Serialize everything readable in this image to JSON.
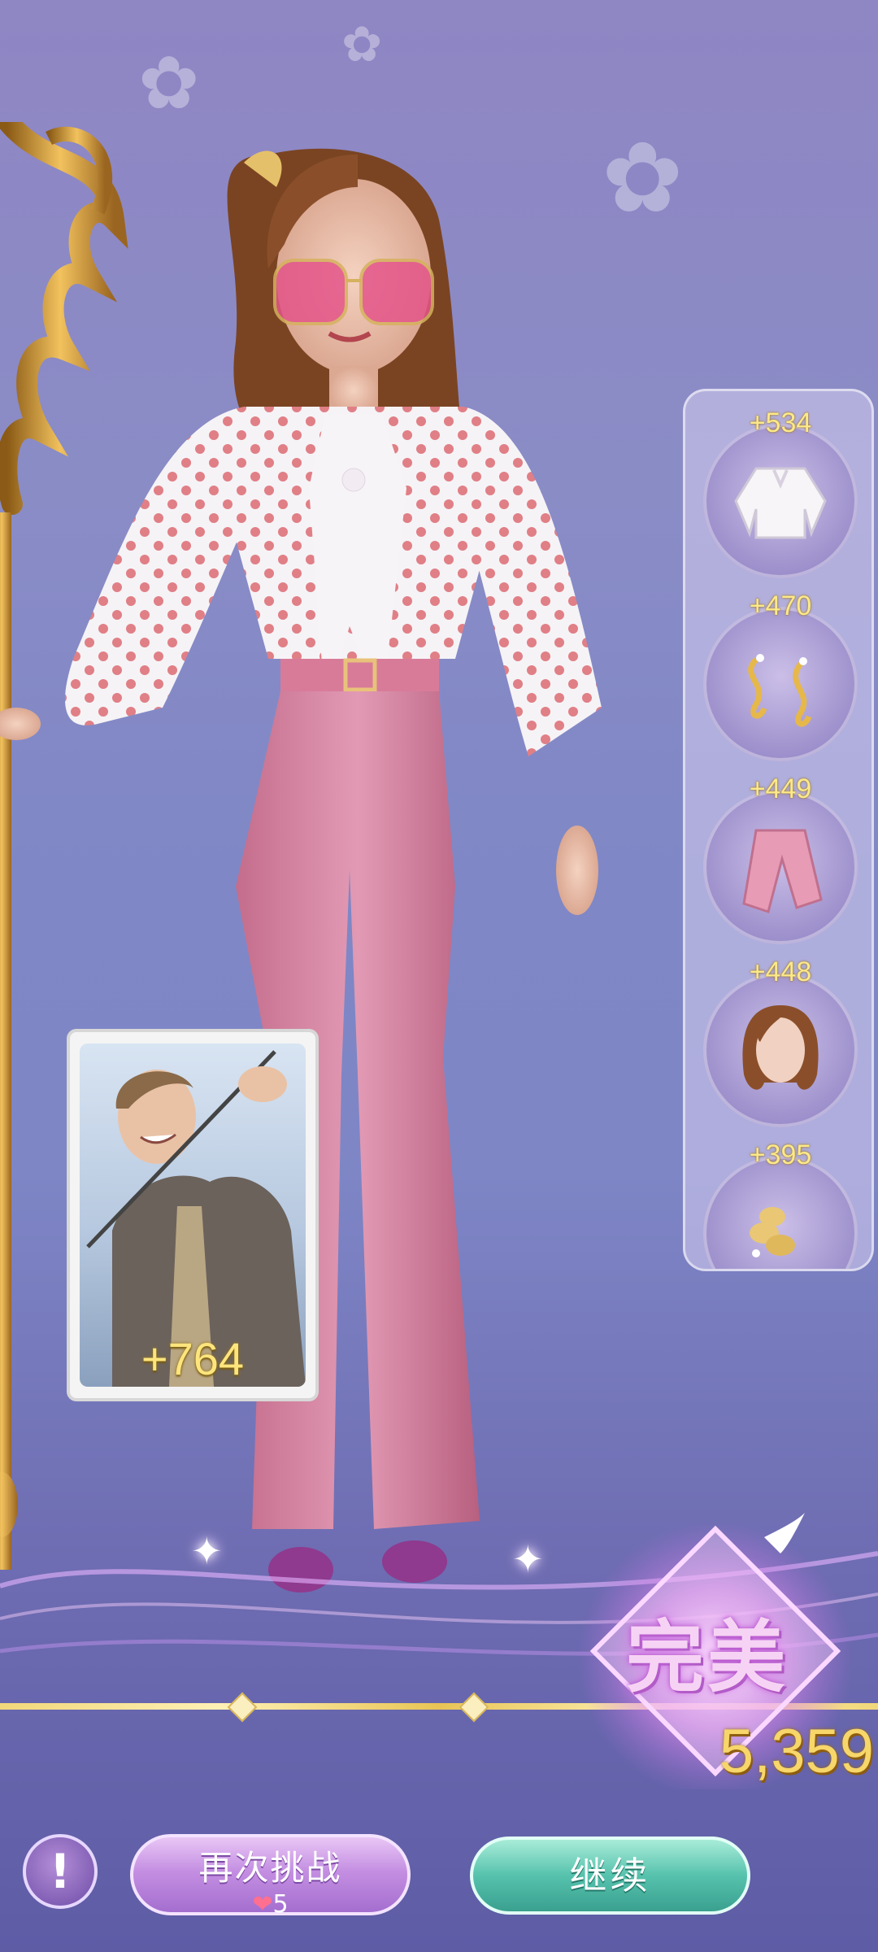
{
  "item_scores": [
    {
      "points": "+534",
      "icon": "blouse-icon"
    },
    {
      "points": "+470",
      "icon": "earrings-icon"
    },
    {
      "points": "+449",
      "icon": "pants-icon"
    },
    {
      "points": "+448",
      "icon": "hair-icon"
    },
    {
      "points": "+395",
      "icon": "hair-accessory-icon"
    }
  ],
  "partner_card": {
    "points": "+764"
  },
  "result": {
    "rating": "完美",
    "total_score": "5,359"
  },
  "buttons": {
    "info_label": "!",
    "retry_label": "再次挑战",
    "retry_cost": "5",
    "continue_label": "继续"
  },
  "colors": {
    "score_gold": "#f7d66a",
    "retry": "#c48fe2",
    "continue": "#56c2ad"
  }
}
